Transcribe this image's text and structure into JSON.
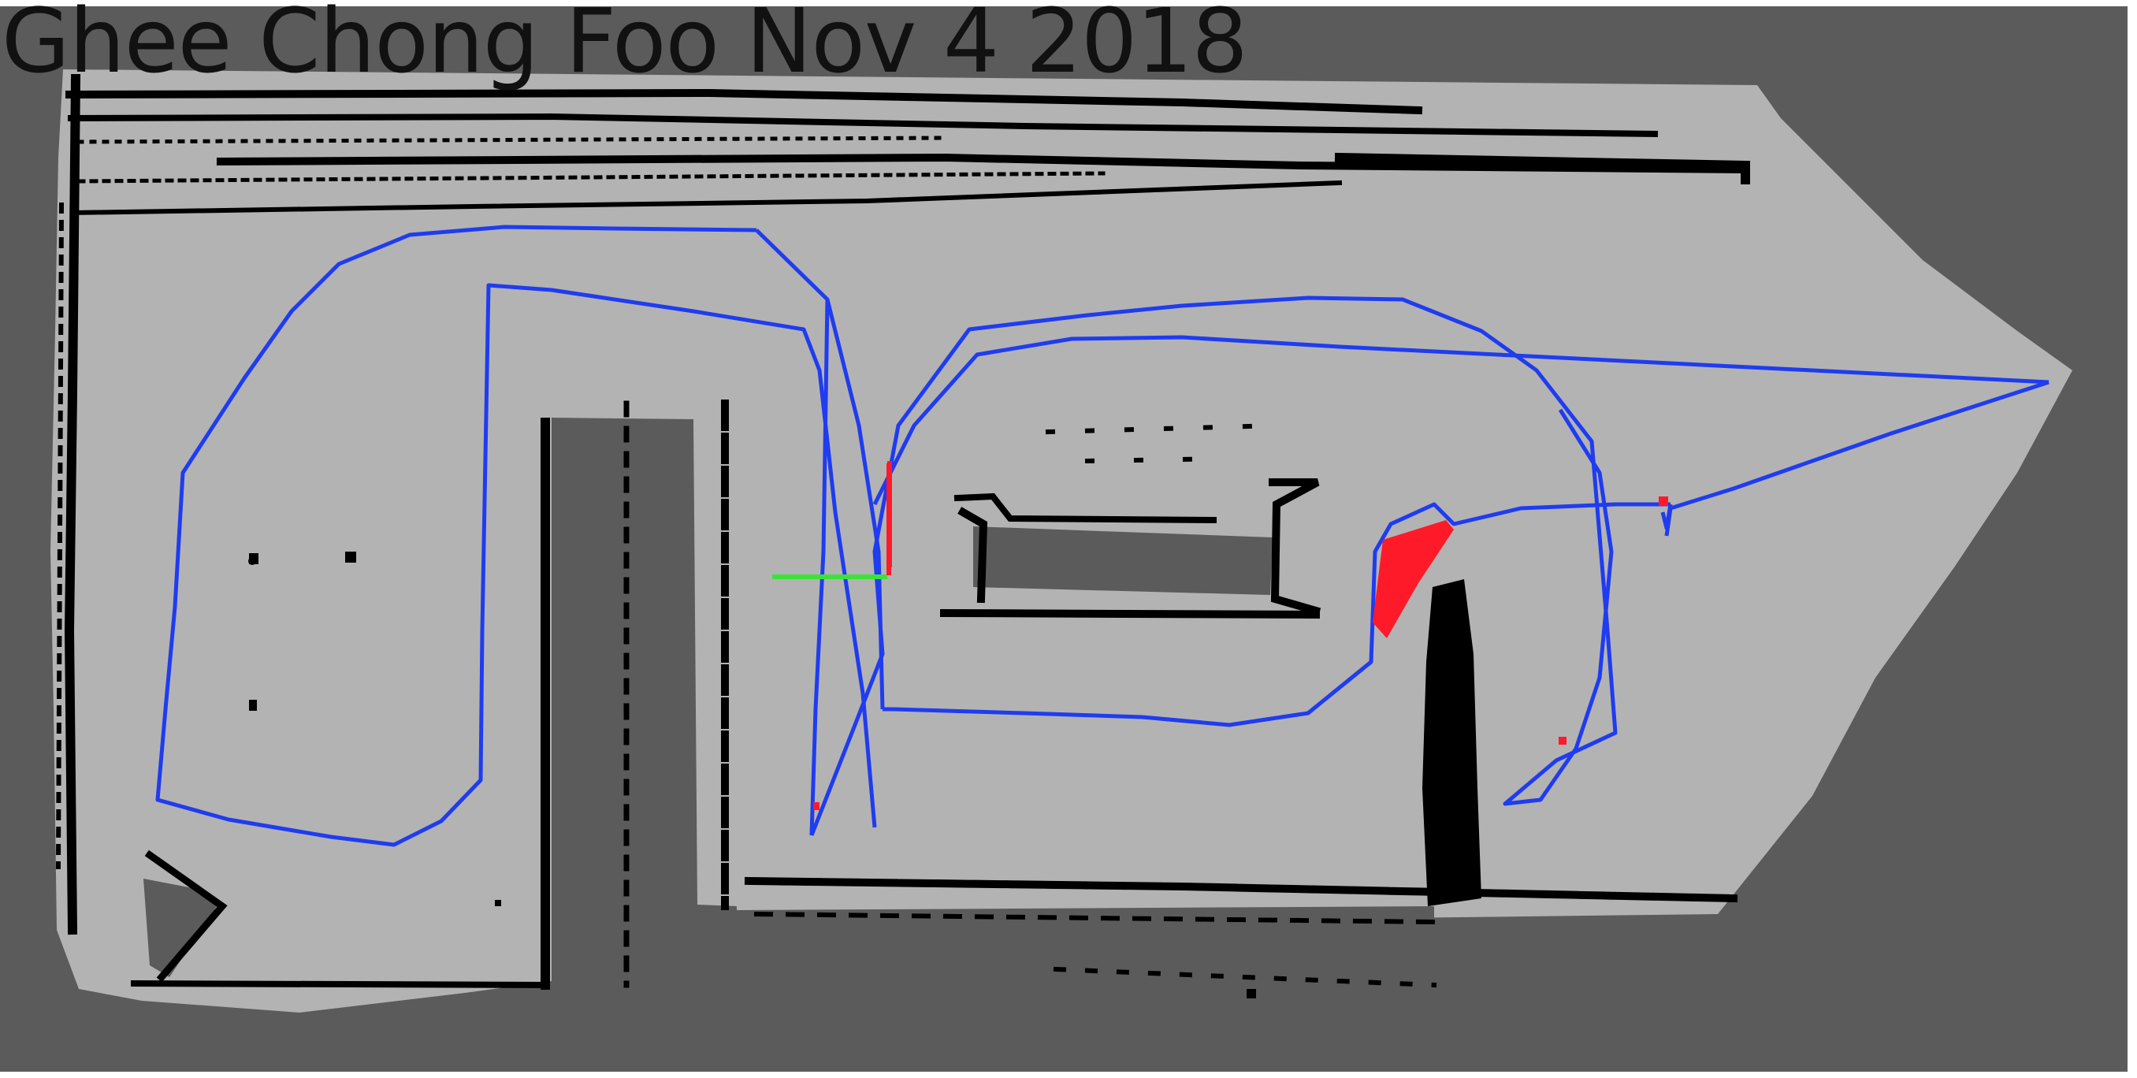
{
  "title": "Ghee Chong Foo Nov 4 2018",
  "map": {
    "colors": {
      "unknown": "#5b5b5b",
      "free": "#b3b3b3",
      "occupied": "#000000",
      "frame": "#ffffff",
      "trajectory": "#1f3cf0",
      "laser_hits": "#ff1a2a",
      "axis_x": "#3ce23c",
      "axis_y": "#ff1a2a"
    },
    "layers": [
      "occupancy-grid",
      "robot-trajectory",
      "laser-hits",
      "robot-pose-axes"
    ]
  }
}
